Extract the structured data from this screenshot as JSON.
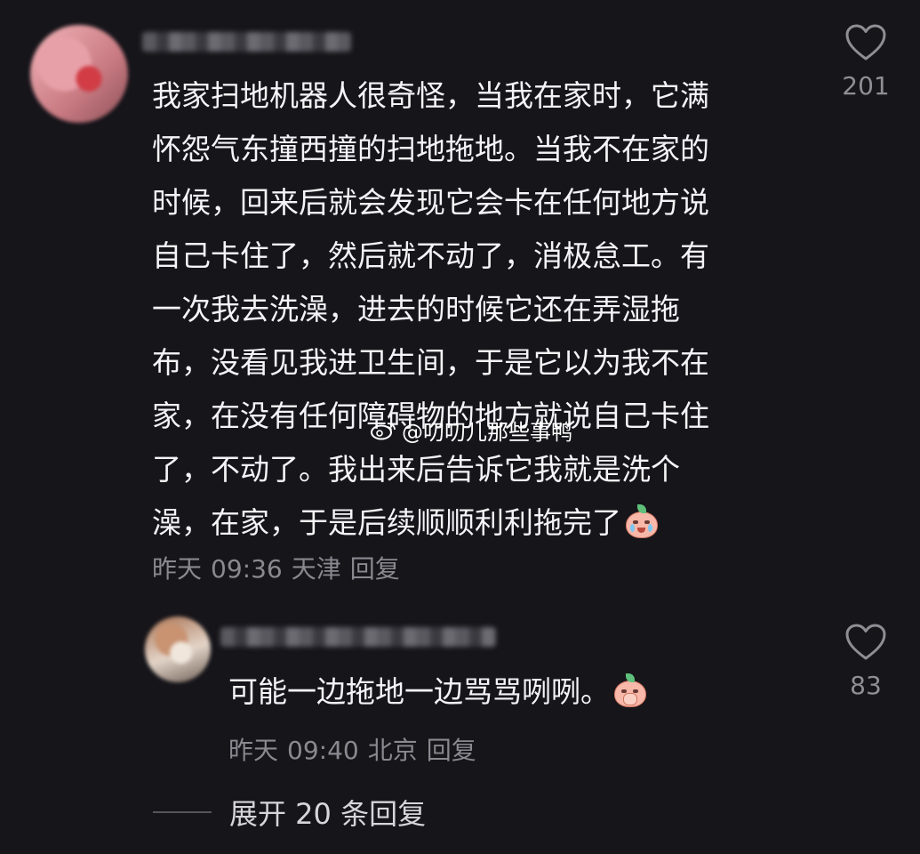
{
  "main_comment": {
    "text_lines": [
      "我家扫地机器人很奇怪，当我在家时，它满",
      "怀怨气东撞西撞的扫地拖地。当我不在家的",
      "时候，回来后就会发现它会卡在任何地方说",
      "自己卡住了，然后就不动了，消极怠工。有",
      "一次我去洗澡，进去的时候它还在弄湿拖",
      "布，没看见我进卫生间，于是它以为我不在",
      "家，在没有任何障碍物的地方就说自己卡住",
      "了，不动了。我出来后告诉它我就是洗个",
      "澡，在家，于是后续顺顺利利拖完了"
    ],
    "emoji": "crying-laughing-peach-emoji",
    "date": "昨天",
    "time": "09:36",
    "location": "天津",
    "reply_label": "回复",
    "like_count": "201"
  },
  "reply_comment": {
    "text": "可能一边拖地一边骂骂咧咧。",
    "emoji": "covering-mouth-peach-emoji",
    "date": "昨天",
    "time": "09:40",
    "location": "北京",
    "reply_label": "回复",
    "like_count": "83"
  },
  "expand_replies": {
    "label": "展开 20 条回复"
  },
  "watermark": {
    "icon": "weibo-icon",
    "text": "@叨叨儿那些事鸭"
  },
  "colors": {
    "background": "#16151a",
    "text": "#f4f4f6",
    "meta": "#8a8990"
  }
}
